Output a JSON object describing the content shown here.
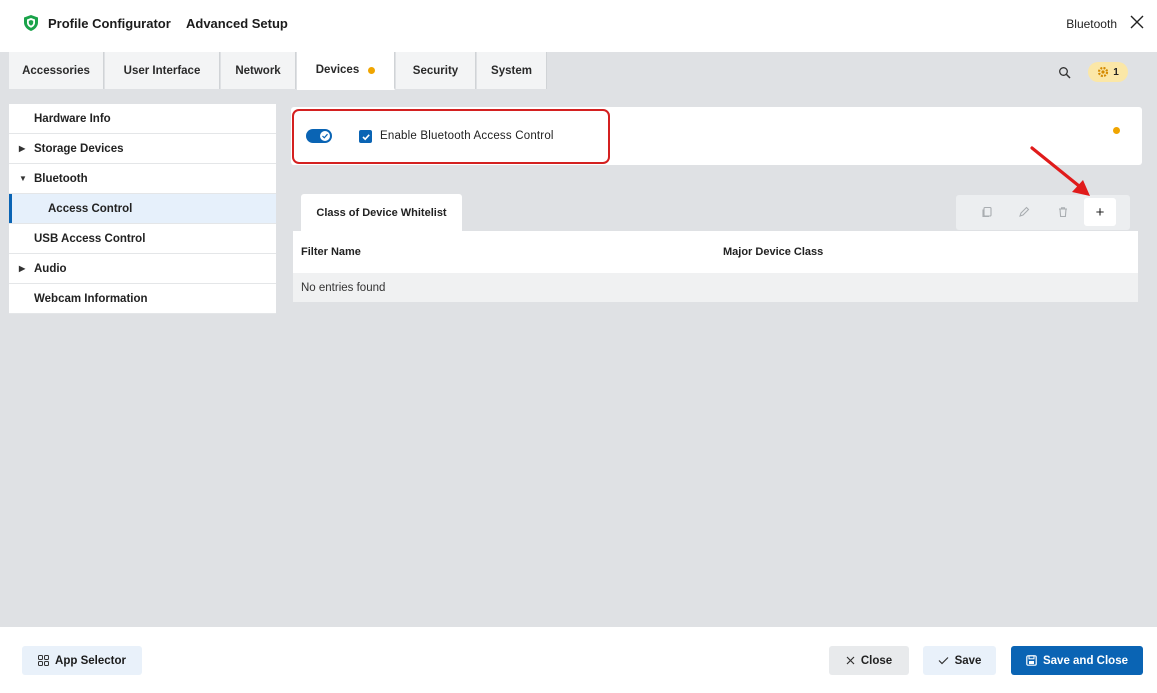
{
  "header": {
    "app_title": "Profile Configurator",
    "sub_title": "Advanced Setup",
    "context_label": "Bluetooth"
  },
  "tabs": [
    {
      "label": "Accessories"
    },
    {
      "label": "User Interface"
    },
    {
      "label": "Network"
    },
    {
      "label": "Devices",
      "active": true,
      "modified": true
    },
    {
      "label": "Security"
    },
    {
      "label": "System"
    }
  ],
  "notifications": {
    "count": "1"
  },
  "sidebar": {
    "items": [
      {
        "label": "Hardware Info"
      },
      {
        "label": "Storage Devices",
        "expandable": true
      },
      {
        "label": "Bluetooth",
        "expanded": true
      },
      {
        "label": "Access Control",
        "selected": true
      },
      {
        "label": "USB Access Control"
      },
      {
        "label": "Audio",
        "expandable": true
      },
      {
        "label": "Webcam Information"
      }
    ]
  },
  "enable": {
    "label": "Enable Bluetooth Access Control",
    "toggle_on": true,
    "checked": true
  },
  "whitelist": {
    "tab_label": "Class of Device Whitelist",
    "columns": [
      "Filter Name",
      "Major Device Class"
    ],
    "empty_text": "No entries found",
    "add_label": "+"
  },
  "footer": {
    "app_selector": "App Selector",
    "close": "Close",
    "save": "Save",
    "save_and_close": "Save and Close"
  },
  "colors": {
    "accent": "#0a64b4",
    "modified_dot": "#f0a500",
    "highlight": "#d42020",
    "logo": "#1aa34a"
  }
}
